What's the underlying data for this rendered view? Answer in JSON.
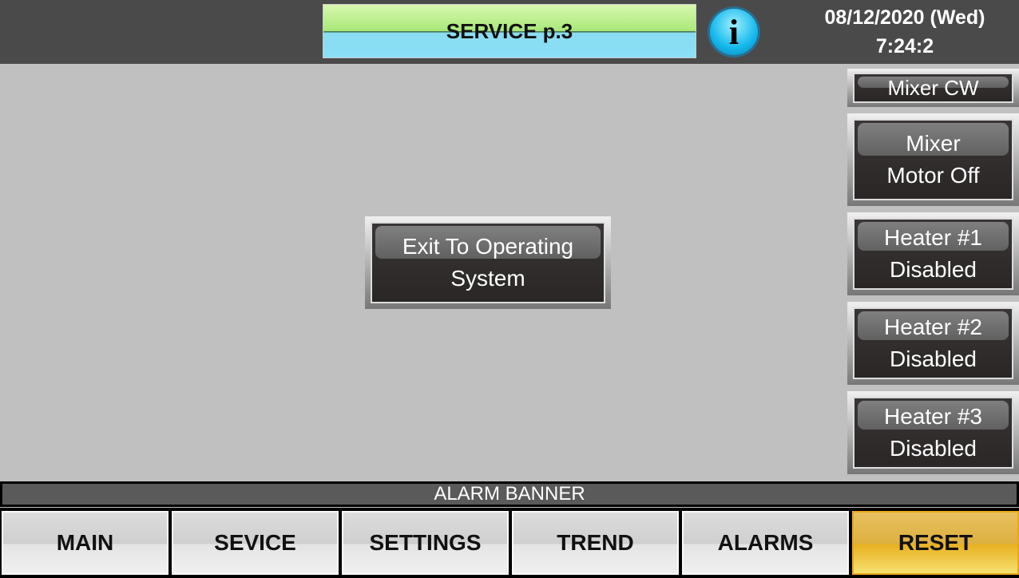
{
  "header": {
    "title": "SERVICE p.3",
    "info_icon": "info-icon",
    "date": "08/12/2020 (Wed)",
    "time": "7:24:2"
  },
  "center": {
    "exit_button": [
      "Exit To Operating",
      "System"
    ]
  },
  "side": {
    "mixer_cw": "Mixer CW",
    "mixer_motor": [
      "Mixer",
      "Motor Off"
    ],
    "heater1": [
      "Heater #1",
      "Disabled"
    ],
    "heater2": [
      "Heater #2",
      "Disabled"
    ],
    "heater3": [
      "Heater #3",
      "Disabled"
    ]
  },
  "alarm_banner": "ALARM BANNER",
  "nav": [
    "MAIN",
    "SEVICE",
    "SETTINGS",
    "TREND",
    "ALARMS",
    "RESET"
  ],
  "colors": {
    "reset": "#e8b020",
    "background": "#c0c0c0",
    "topbar": "#4a4a4a"
  }
}
